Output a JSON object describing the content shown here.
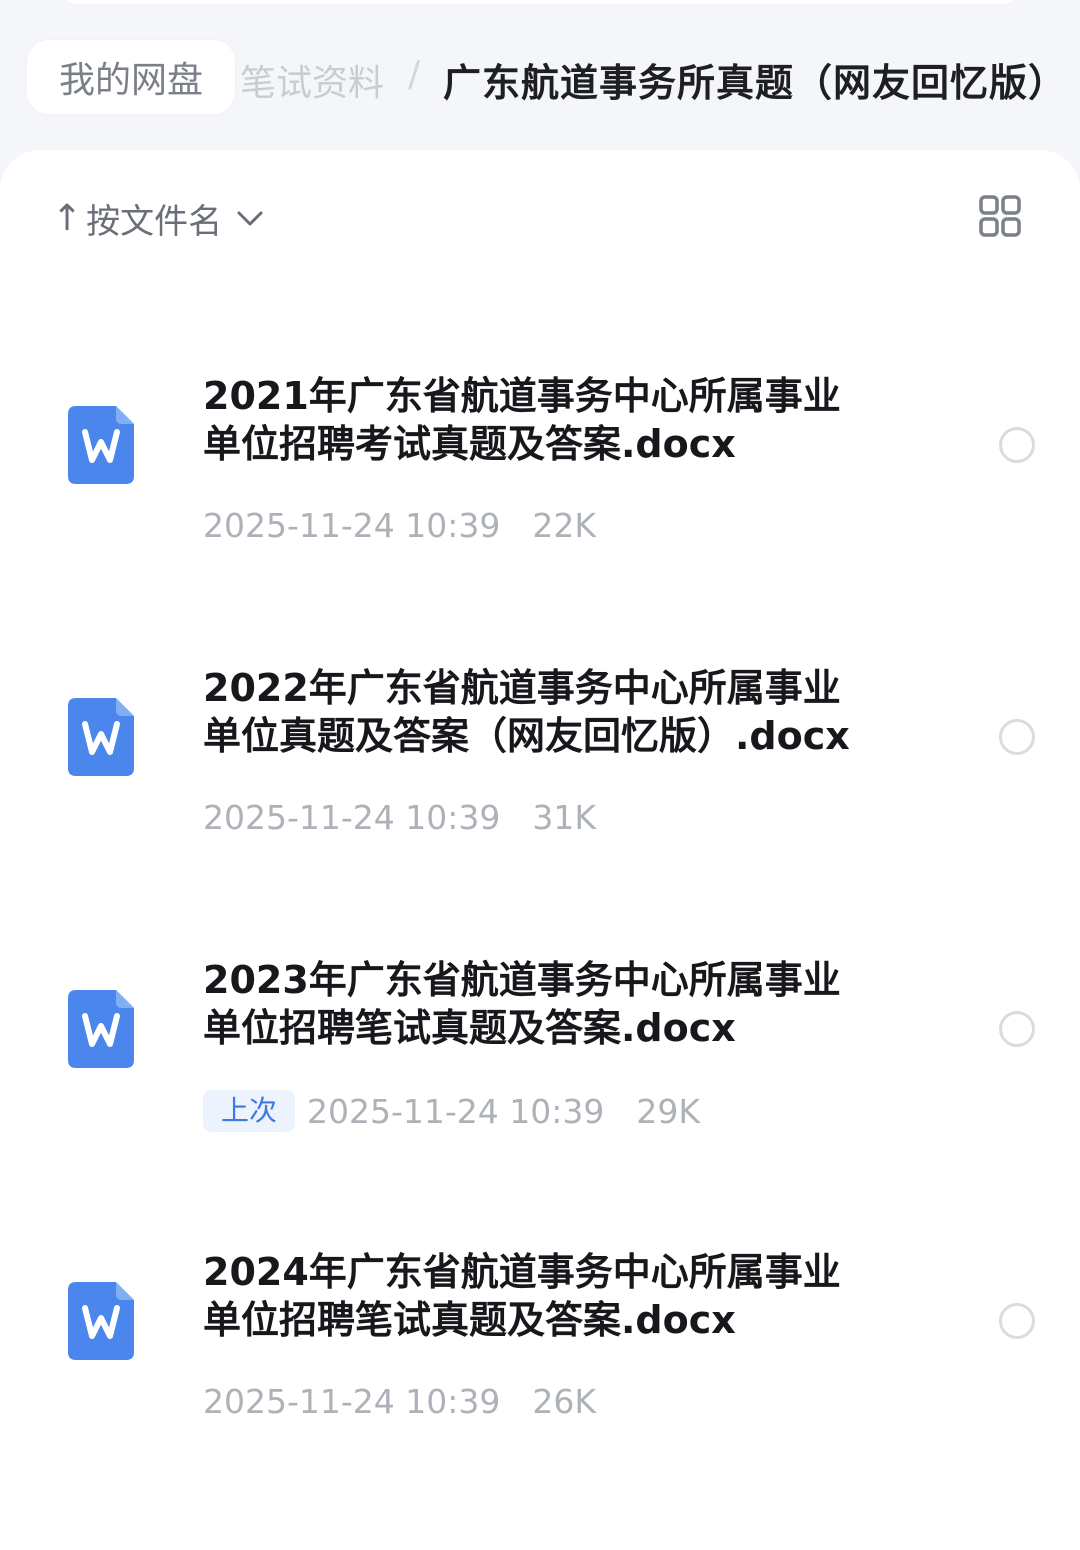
{
  "breadcrumb": {
    "root": "我的网盘",
    "parent": "笔试资料",
    "separator": "/",
    "current": "广东航道事务所真题（网友回忆版）"
  },
  "toolbar": {
    "sort_arrow": "↑",
    "sort_label": "按文件名",
    "sort_chevron": "∨",
    "grid_icon": "grid-view-icon"
  },
  "files": [
    {
      "name_line1": "2021年广东省航道事务中心所属事业",
      "name_line2": "单位招聘考试真题及答案.docx",
      "date": "2025-11-24 10:39",
      "size": "22K",
      "badge": "",
      "icon": "word-file-icon"
    },
    {
      "name_line1": "2022年广东省航道事务中心所属事业",
      "name_line2": "单位真题及答案（网友回忆版）.docx",
      "date": "2025-11-24 10:39",
      "size": "31K",
      "badge": "",
      "icon": "word-file-icon"
    },
    {
      "name_line1": "2023年广东省航道事务中心所属事业",
      "name_line2": "单位招聘笔试真题及答案.docx",
      "date": "2025-11-24 10:39",
      "size": "29K",
      "badge": "上次",
      "icon": "word-file-icon"
    },
    {
      "name_line1": "2024年广东省航道事务中心所属事业",
      "name_line2": "单位招聘笔试真题及答案.docx",
      "date": "2025-11-24 10:39",
      "size": "26K",
      "badge": "",
      "icon": "word-file-icon"
    }
  ],
  "colors": {
    "accent": "#3f78e0",
    "word_icon": "#4a86ec",
    "background": "#f5f6f9"
  }
}
